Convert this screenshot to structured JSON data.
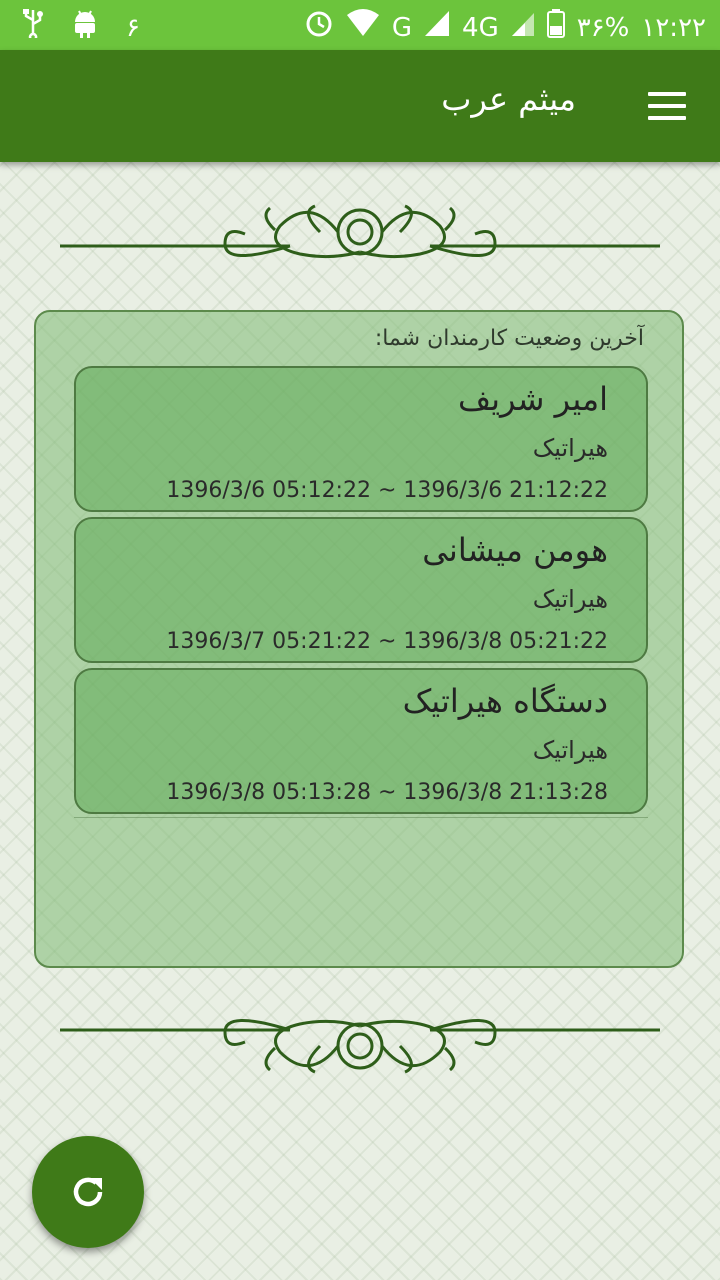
{
  "status_bar": {
    "left_icons": [
      "usb-icon",
      "android-icon"
    ],
    "notification_count": "۶",
    "network": "4G",
    "signal_label": "G",
    "battery": "۳۶%",
    "time": "۱۲:۲۲"
  },
  "app_bar": {
    "title": "میثم عرب",
    "menu_icon": "hamburger-menu-icon"
  },
  "panel": {
    "caption": "آخرین وضعیت کارمندان شما:",
    "items": [
      {
        "name": "امیر شریف",
        "company": "هیراتیک",
        "time_range": "1396/3/6 05:12:22 ~ 1396/3/6 21:12:22"
      },
      {
        "name": "هومن میشانی",
        "company": "هیراتیک",
        "time_range": "1396/3/7 05:21:22 ~ 1396/3/8 05:21:22"
      },
      {
        "name": "دستگاه هیراتیک",
        "company": "هیراتیک",
        "time_range": "1396/3/8 05:13:28 ~ 1396/3/8 21:13:28"
      }
    ]
  },
  "fab": {
    "icon": "refresh-icon"
  },
  "colors": {
    "primary": "#3f7a18",
    "status_bar": "#6cc43c",
    "card": "#5faa55"
  }
}
